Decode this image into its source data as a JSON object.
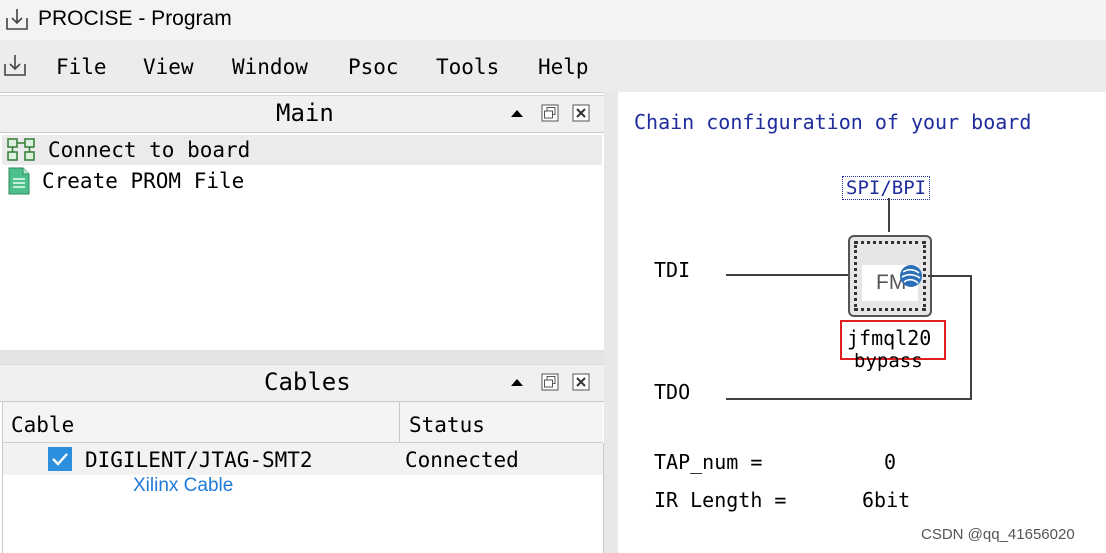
{
  "window": {
    "title": "PROCISE - Program"
  },
  "menu": [
    "File",
    "View",
    "Window",
    "Psoc",
    "Tools",
    "Help"
  ],
  "main_panel": {
    "title": "Main",
    "items": [
      {
        "label": "Connect to board",
        "icon": "board-connect-icon"
      },
      {
        "label": "Create PROM File",
        "icon": "document-icon"
      }
    ]
  },
  "cables_panel": {
    "title": "Cables",
    "columns": [
      "Cable",
      "Status"
    ],
    "rows": [
      {
        "cable": "DIGILENT/JTAG-SMT2",
        "status": "Connected",
        "checked": true
      }
    ],
    "annotation": "Xilinx Cable"
  },
  "chain": {
    "title": "Chain configuration of your board",
    "spi_label": "SPI/BPI",
    "tdi_label": "TDI",
    "tdo_label": "TDO",
    "chip_logo": "FM",
    "device_name": "jfmql20",
    "device_mode": "bypass",
    "tap_label": "TAP_num =",
    "tap_value": "0",
    "ir_label": "IR Length =",
    "ir_value": "6bit"
  },
  "watermark": "CSDN @qq_41656020",
  "colors": {
    "chain_title": "#1f2c9c",
    "annotation": "#1e7ad6",
    "highlight_box": "#e02020",
    "checkbox": "#2b8fe0"
  }
}
